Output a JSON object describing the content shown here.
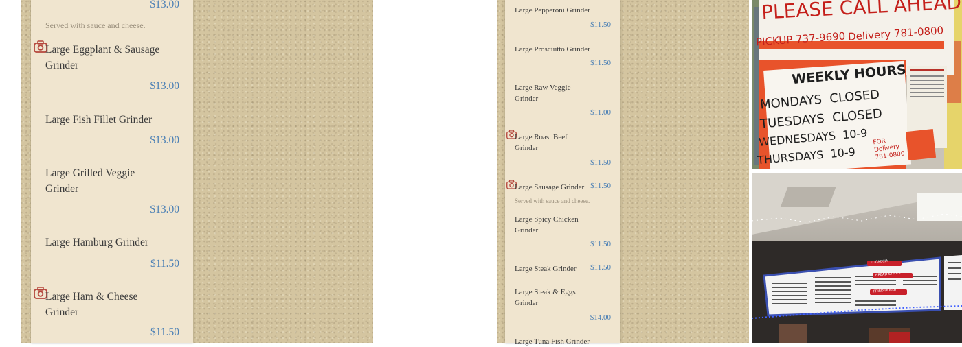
{
  "left_menu": {
    "items": [
      {
        "price": "$13.00",
        "desc": "Served with sauce and cheese."
      },
      {
        "name": "Large Eggplant & Sausage Grinder",
        "price": "$13.00"
      },
      {
        "name": "Large Fish Fillet Grinder",
        "price": "$13.00"
      },
      {
        "name": "Large Grilled Veggie Grinder",
        "price": "$13.00"
      },
      {
        "name": "Large Hamburg Grinder",
        "price": "$11.50"
      },
      {
        "name": "Large Ham & Cheese Grinder",
        "price": "$11.50"
      }
    ]
  },
  "right_menu": {
    "items": [
      {
        "name": "Large Pepperoni Grinder",
        "price": "$11.50"
      },
      {
        "name": "Large Prosciutto Grinder",
        "price": "$11.50"
      },
      {
        "name": "Large Raw Veggie Grinder",
        "price": "$11.00"
      },
      {
        "name": "Large Roast Beef Grinder",
        "price": "$11.50"
      },
      {
        "name": "Large Sausage Grinder",
        "price": "$11.50",
        "desc": "Served with sauce and cheese."
      },
      {
        "name": "Large Spicy Chicken Grinder",
        "price": "$11.50"
      },
      {
        "name": "Large Steak Grinder",
        "price": "$11.50"
      },
      {
        "name": "Large Steak & Eggs Grinder",
        "price": "$14.00"
      },
      {
        "name": "Large Tuna Fish Grinder"
      }
    ]
  },
  "sign_photo": {
    "line1": "PLEASE CALL AHEAD",
    "pickup": "PICKUP 737-9690",
    "delivery": "Delivery 781-0800",
    "hours_title": "WEEKLY HOURS",
    "mon": "MONDAYS",
    "mon_v": "CLOSED",
    "tue": "TUESDAYS",
    "tue_v": "CLOSED",
    "wed": "WEDNESDAYS",
    "wed_v": "10-9",
    "thu": "THURSDAYS",
    "thu_v": "10-9",
    "note": "FOR Delivery 781-0800"
  },
  "board_photo": {
    "h1": "FOCACCIA",
    "h2": "BREAD STICKS",
    "h3": "FRIED DOUGH"
  },
  "colors": {
    "price_blue": "#4a7fb5",
    "stucco": "#d4c5a0",
    "paper": "#f0e5cf",
    "camera_icon": "#b5463c"
  }
}
